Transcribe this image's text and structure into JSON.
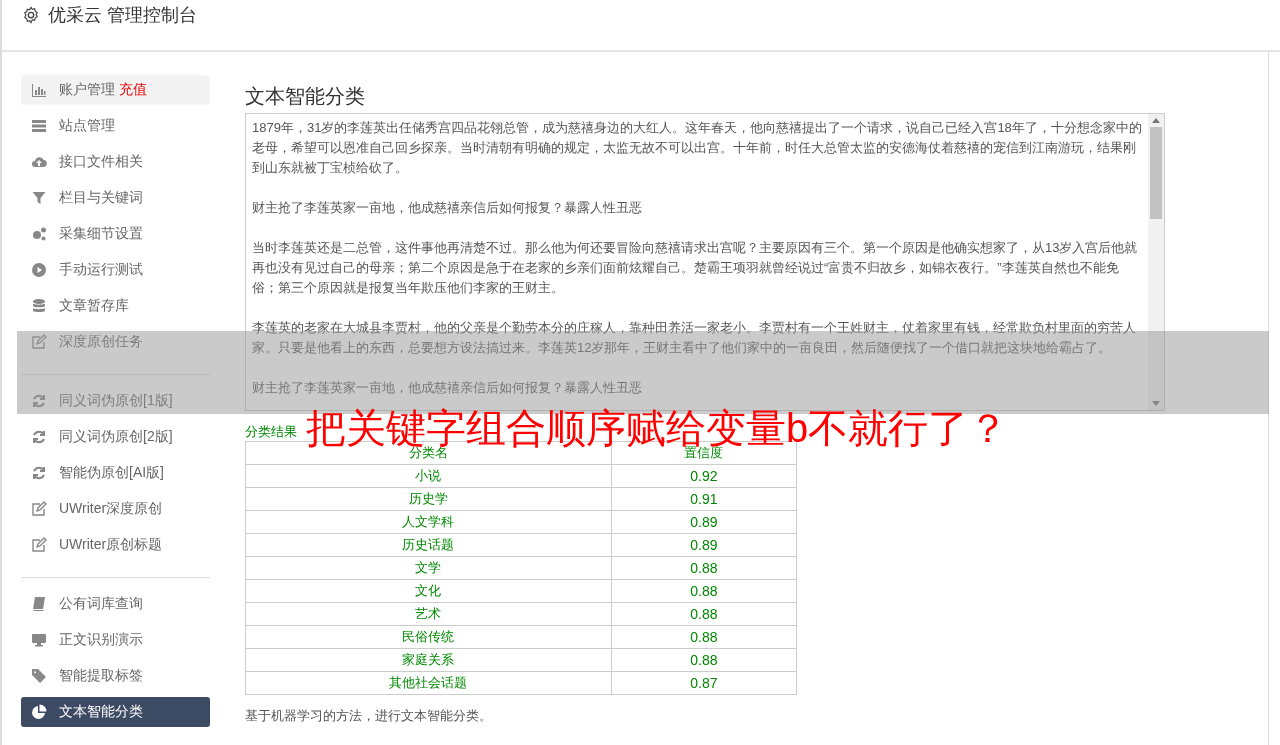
{
  "header": {
    "title": "优采云 管理控制台"
  },
  "sidebar": {
    "groups": [
      [
        {
          "label": "账户管理",
          "badge": "充值",
          "selected": false,
          "highlighted": true
        },
        {
          "label": "站点管理",
          "selected": false,
          "highlighted": false
        },
        {
          "label": "接口文件相关",
          "selected": false,
          "highlighted": false
        },
        {
          "label": "栏目与关键词",
          "selected": false,
          "highlighted": false
        },
        {
          "label": "采集细节设置",
          "selected": false,
          "highlighted": false
        },
        {
          "label": "手动运行测试",
          "selected": false,
          "highlighted": false
        },
        {
          "label": "文章暂存库",
          "selected": false,
          "highlighted": false
        },
        {
          "label": "深度原创任务",
          "selected": false,
          "highlighted": false
        }
      ],
      [
        {
          "label": "同义词伪原创[1版]",
          "selected": false,
          "highlighted": false
        },
        {
          "label": "同义词伪原创[2版]",
          "selected": false,
          "highlighted": false
        },
        {
          "label": "智能伪原创[AI版]",
          "selected": false,
          "highlighted": false
        },
        {
          "label": "UWriter深度原创",
          "selected": false,
          "highlighted": false
        },
        {
          "label": "UWriter原创标题",
          "selected": false,
          "highlighted": false
        }
      ],
      [
        {
          "label": "公有词库查询",
          "selected": false,
          "highlighted": false
        },
        {
          "label": "正文识别演示",
          "selected": false,
          "highlighted": false
        },
        {
          "label": "智能提取标签",
          "selected": false,
          "highlighted": false
        },
        {
          "label": "文本智能分类",
          "selected": true,
          "highlighted": false
        }
      ]
    ]
  },
  "main": {
    "title": "文本智能分类",
    "text_area": {
      "value": [
        "1879年，31岁的李莲英出任储秀宫四品花翎总管，成为慈禧身边的大红人。这年春天，他向慈禧提出了一个请求，说自己已经入宫18年了，十分想念家中的老母，希望可以恩准自己回乡探亲。当时清朝有明确的规定，太监无故不可以出宫。十年前，时任大总管太监的安德海仗着慈禧的宠信到江南游玩，结果刚到山东就被丁宝桢给砍了。",
        "财主抢了李莲英家一亩地，他成慈禧亲信后如何报复？暴露人性丑恶",
        "当时李莲英还是二总管，这件事他再清楚不过。那么他为何还要冒险向慈禧请求出宫呢？主要原因有三个。第一个原因是他确实想家了，从13岁入宫后他就再也没有见过自己的母亲；第二个原因是急于在老家的乡亲们面前炫耀自己。楚霸王项羽就曾经说过“富贵不归故乡，如锦衣夜行。”李莲英自然也不能免俗；第三个原因就是报复当年欺压他们李家的王财主。",
        "李莲英的老家在大城县李贾村，他的父亲是个勤劳本分的庄稼人，靠种田养活一家老小。李贾村有一个王姓财主，仗着家里有钱，经常欺负村里面的穷苦人家。只要是他看上的东西，总要想方设法搞过来。李莲英12岁那年，王财主看中了他们家中的一亩良田，然后随便找了一个借口就把这块地给霸占了。",
        "财主抢了李莲英家一亩地，他成慈禧亲信后如何报复？暴露人性丑恶"
      ]
    },
    "result_label": "分类结果",
    "table": {
      "columns": [
        "分类名",
        "置信度"
      ],
      "rows": [
        [
          "小说",
          "0.92"
        ],
        [
          "历史学",
          "0.91"
        ],
        [
          "人文学科",
          "0.89"
        ],
        [
          "历史话题",
          "0.89"
        ],
        [
          "文学",
          "0.88"
        ],
        [
          "文化",
          "0.88"
        ],
        [
          "艺术",
          "0.88"
        ],
        [
          "民俗传统",
          "0.88"
        ],
        [
          "家庭关系",
          "0.88"
        ],
        [
          "其他社会话题",
          "0.87"
        ]
      ]
    },
    "note": "基于机器学习的方法，进行文本智能分类。"
  },
  "caption": {
    "text": "把关键字组合顺序赋给变量b不就行了？"
  }
}
